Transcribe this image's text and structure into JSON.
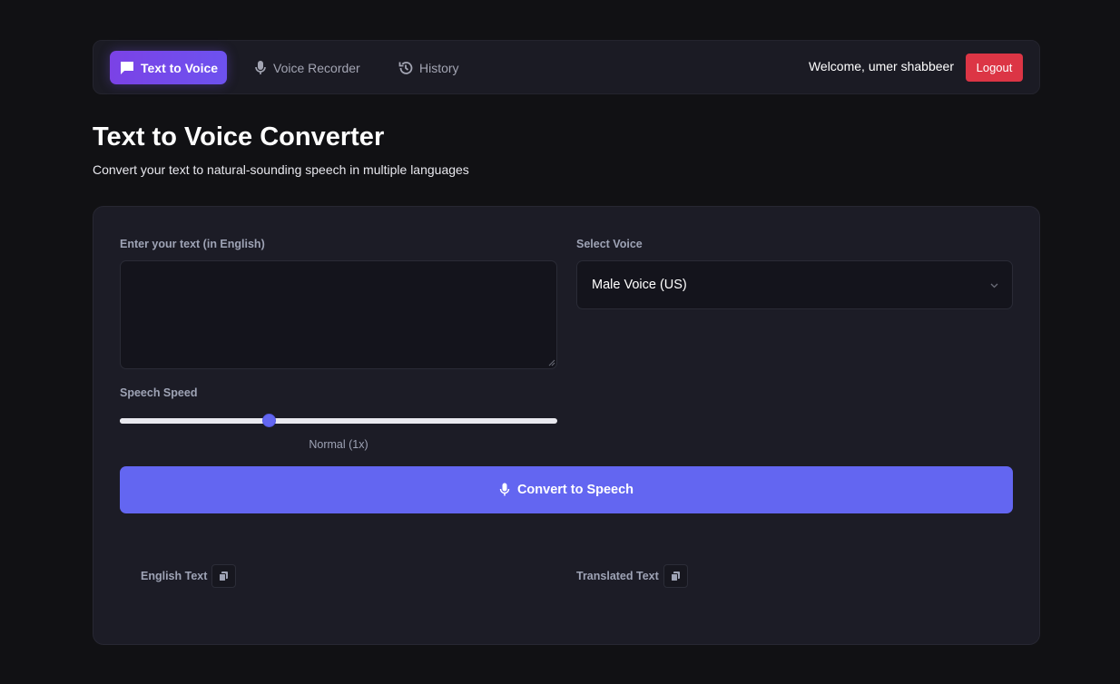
{
  "nav": {
    "tabs": [
      {
        "label": "Text to Voice",
        "icon": "chat-bubble-icon",
        "active": true
      },
      {
        "label": "Voice Recorder",
        "icon": "microphone-icon",
        "active": false
      },
      {
        "label": "History",
        "icon": "history-icon",
        "active": false
      }
    ],
    "welcome": "Welcome, umer shabbeer",
    "logout_label": "Logout"
  },
  "header": {
    "title": "Text to Voice Converter",
    "subtitle": "Convert your text to natural-sounding speech in multiple languages"
  },
  "form": {
    "text_label": "Enter your text (in English)",
    "text_value": "",
    "text_placeholder": "",
    "voice_label": "Select Voice",
    "voice_selected": "Male Voice (US)",
    "speed_label": "Speech Speed",
    "speed_value_fraction": 0.34,
    "speed_readout": "Normal (1x)",
    "convert_label": "Convert to Speech"
  },
  "output": {
    "english_label": "English Text",
    "translated_label": "Translated Text"
  },
  "colors": {
    "accent": "#6366f1",
    "active_tab": "#7b42e6",
    "logout": "#dc3545",
    "background": "#111114",
    "card": "#1c1c26"
  }
}
